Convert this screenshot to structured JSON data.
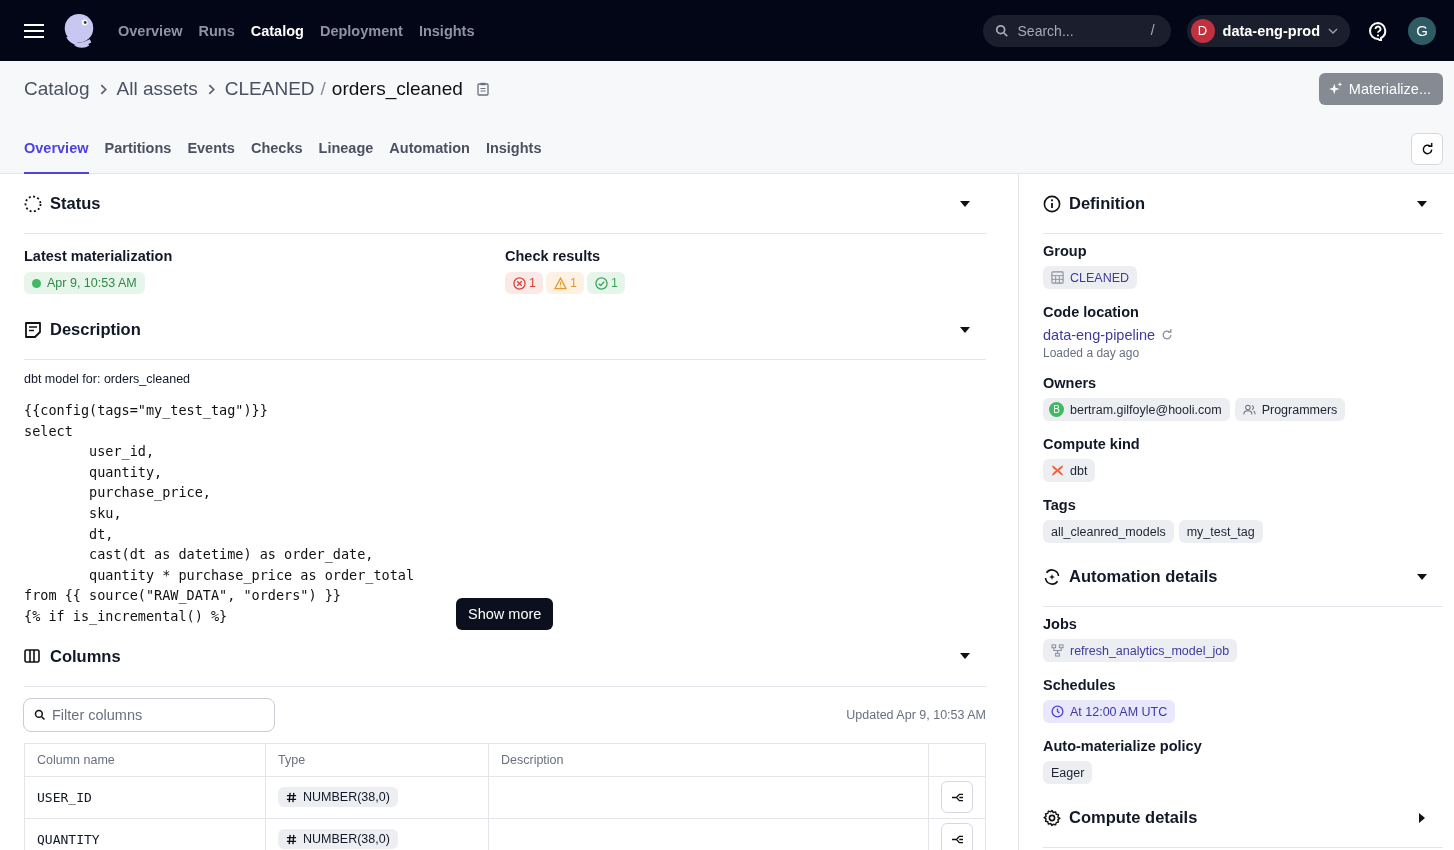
{
  "top_nav": {
    "nav_items": [
      {
        "label": "Overview",
        "selected": false
      },
      {
        "label": "Runs",
        "selected": false
      },
      {
        "label": "Catalog",
        "selected": true
      },
      {
        "label": "Deployment",
        "selected": false
      },
      {
        "label": "Insights",
        "selected": false
      }
    ],
    "search": {
      "placeholder": "Search...",
      "shortcut": "/"
    },
    "deployment": {
      "initial": "D",
      "name": "data-eng-prod"
    },
    "user_initial": "G"
  },
  "breadcrumb": {
    "items": [
      "Catalog",
      "All assets"
    ],
    "group": "CLEANED",
    "separator": "/",
    "asset": "orders_cleaned"
  },
  "materialize_button": "Materialize...",
  "tabs": [
    {
      "label": "Overview",
      "selected": true
    },
    {
      "label": "Partitions",
      "selected": false
    },
    {
      "label": "Events",
      "selected": false
    },
    {
      "label": "Checks",
      "selected": false
    },
    {
      "label": "Lineage",
      "selected": false
    },
    {
      "label": "Automation",
      "selected": false
    },
    {
      "label": "Insights",
      "selected": false
    }
  ],
  "status": {
    "title": "Status",
    "expanded": true,
    "latest_label": "Latest materialization",
    "latest_time": "Apr 9, 10:53 AM",
    "checks_label": "Check results",
    "checks": [
      {
        "kind": "error",
        "count": "1"
      },
      {
        "kind": "warning",
        "count": "1"
      },
      {
        "kind": "success",
        "count": "1"
      }
    ]
  },
  "description": {
    "title": "Description",
    "expanded": true,
    "summary": "dbt model for: orders_cleaned",
    "code": [
      "{{config(tags=\"my_test_tag\")}}",
      "select",
      "        user_id,",
      "        quantity,",
      "        purchase_price,",
      "        sku,",
      "        dt,",
      "        cast(dt as datetime) as order_date,",
      "        quantity * purchase_price as order_total",
      "from {{ source(\"RAW_DATA\", \"orders\") }}",
      "{% if is_incremental() %}"
    ],
    "show_more": "Show more"
  },
  "columns": {
    "title": "Columns",
    "expanded": true,
    "filter_placeholder": "Filter columns",
    "updated": "Updated Apr 9, 10:53 AM",
    "headers": [
      "Column name",
      "Type",
      "Description"
    ],
    "rows": [
      {
        "name": "USER_ID",
        "type": "NUMBER(38,0)"
      },
      {
        "name": "QUANTITY",
        "type": "NUMBER(38,0)"
      }
    ]
  },
  "definition": {
    "title": "Definition",
    "expanded": true,
    "group_label": "Group",
    "group": "CLEANED",
    "code_location_label": "Code location",
    "code_location": "data-eng-pipeline",
    "loaded": "Loaded a day ago",
    "owners_label": "Owners",
    "owners": [
      {
        "kind": "user",
        "initial": "B",
        "name": "bertram.gilfoyle@hooli.com"
      },
      {
        "kind": "team",
        "name": "Programmers"
      }
    ],
    "compute_kind_label": "Compute kind",
    "compute_kind": "dbt",
    "tags_label": "Tags",
    "tags": [
      "all_cleanred_models",
      "my_test_tag"
    ]
  },
  "automation": {
    "title": "Automation details",
    "expanded": true,
    "jobs_label": "Jobs",
    "jobs": [
      "refresh_analytics_model_job"
    ],
    "schedules_label": "Schedules",
    "schedules": [
      "At 12:00 AM UTC"
    ],
    "policy_label": "Auto-materialize policy",
    "policy": "Eager"
  },
  "compute_details": {
    "title": "Compute details",
    "expanded": false
  }
}
